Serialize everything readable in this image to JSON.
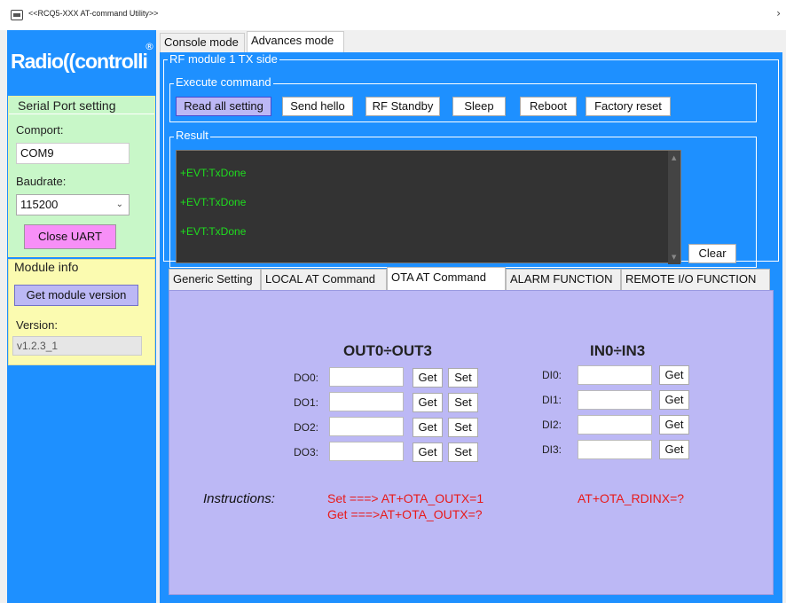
{
  "window": {
    "title": "<<RCQ5-XXX AT-command Utility>>",
    "chevron": "›"
  },
  "logo": {
    "text": "Radio((controlli",
    "reg": "®"
  },
  "serial_port": {
    "legend": "Serial Port setting",
    "comport_label": "Comport:",
    "comport_value": "COM9",
    "baudrate_label": "Baudrate:",
    "baudrate_value": "115200",
    "close_uart": "Close UART"
  },
  "module_info": {
    "legend": "Module info",
    "get_version_button": "Get module version",
    "version_label": "Version:",
    "version_value": "v1.2.3_1"
  },
  "top_tabs": [
    "Console mode",
    "Advances mode"
  ],
  "rf_module": {
    "legend": "RF module 1 TX side",
    "execute_legend": "Execute command",
    "buttons": [
      "Read all setting",
      "Send hello",
      "RF Standby",
      "Sleep",
      "Reboot",
      "Factory reset"
    ],
    "result_legend": "Result",
    "console_lines": [
      "+EVT:TxDone",
      "+EVT:TxDone",
      "+EVT:TxDone"
    ],
    "clear_button": "Clear"
  },
  "bottom_tabs": [
    "Generic Setting",
    "LOCAL AT Command",
    "OTA AT Command",
    "ALARM FUNCTION",
    "REMOTE I/O FUNCTION"
  ],
  "ota": {
    "out_title": "OUT0÷OUT3",
    "in_title": "IN0÷IN3",
    "out_rows": [
      "DO0:",
      "DO1:",
      "DO2:",
      "DO3:"
    ],
    "in_rows": [
      "DI0:",
      "DI1:",
      "DI2:",
      "DI3:"
    ],
    "get_label": "Get",
    "set_label": "Set",
    "instructions_label": "Instructions:",
    "instr_set": "Set ===> AT+OTA_OUTX=1",
    "instr_get": "Get ===>AT+OTA_OUTX=?",
    "instr_in": "AT+OTA_RDINX=?"
  },
  "colors": {
    "panel_blue": "#1e90ff",
    "serial_green": "#c8f7c8",
    "module_yellow": "#fbfbb0",
    "lavender": "#bcb8f5",
    "console_bg": "#333333",
    "console_text": "#1fdc1f",
    "instruction_red": "#e81a1a",
    "pink_button": "#f78ff7"
  }
}
